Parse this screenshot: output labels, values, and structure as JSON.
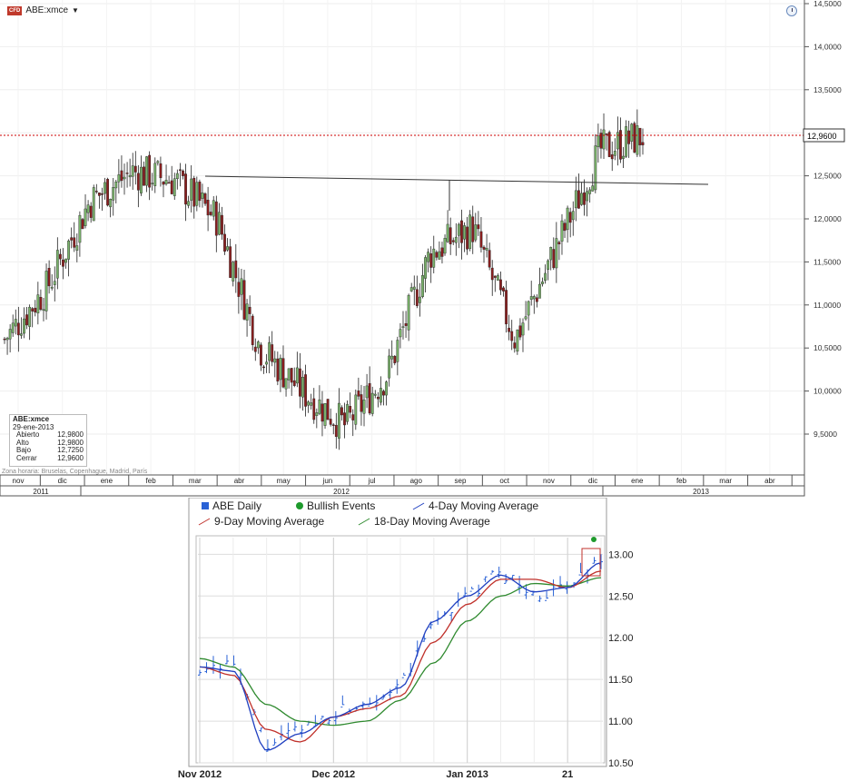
{
  "top": {
    "symbol": "ABE:xmce",
    "badge": "CFD",
    "price_tag": "12,9600",
    "y_ticks": [
      "14,5000",
      "14,0000",
      "13,5000",
      "13,0000",
      "12,5000",
      "12,0000",
      "11,5000",
      "11,0000",
      "10,5000",
      "10,0000",
      "9,5000"
    ],
    "months": [
      "nov",
      "dic",
      "ene",
      "feb",
      "mar",
      "abr",
      "may",
      "jun",
      "jul",
      "ago",
      "sep",
      "oct",
      "nov",
      "dic",
      "ene",
      "feb",
      "mar",
      "abr"
    ],
    "years": [
      "2011",
      "2012",
      "2013"
    ],
    "timezone": "Zona horaria: Bruselas, Copenhague, Madrid, París",
    "info": {
      "name": "ABE:xmce",
      "date": "29-ene-2013",
      "rows": [
        {
          "label": "Abierto",
          "value": "12,9800"
        },
        {
          "label": "Alto",
          "value": "12,9800"
        },
        {
          "label": "Bajo",
          "value": "12,7250"
        },
        {
          "label": "Cerrar",
          "value": "12,9600"
        }
      ]
    }
  },
  "chart_data": [
    {
      "type": "line",
      "title": "ABE:xmce",
      "x": [
        "2011-11-01",
        "2011-12-01",
        "2012-01-01",
        "2012-02-01",
        "2012-03-01",
        "2012-04-01",
        "2012-05-01",
        "2012-06-01",
        "2012-07-01",
        "2012-08-01",
        "2012-09-01",
        "2012-10-01",
        "2012-11-01",
        "2012-12-01",
        "2013-01-01",
        "2013-01-29"
      ],
      "series": [
        {
          "name": "",
          "values": [
            10.6,
            11.2,
            12.2,
            12.55,
            12.45,
            12.0,
            10.5,
            10.0,
            9.6,
            10.2,
            11.6,
            11.9,
            10.6,
            11.7,
            12.8,
            12.96
          ]
        }
      ],
      "ylim": [
        9.0,
        14.5
      ],
      "reference_lines": [
        {
          "kind": "horizontal-dotted",
          "value": 12.96,
          "color": "#cc0000"
        },
        {
          "kind": "trendline",
          "from": {
            "x": "2012-03-15",
            "y": 12.47
          },
          "to": {
            "x": "2013-03-01",
            "y": 12.38
          }
        }
      ],
      "grid": true
    },
    {
      "type": "line",
      "x": [
        "2012-11-01",
        "2012-11-08",
        "2012-11-15",
        "2012-11-22",
        "2012-12-01",
        "2012-12-08",
        "2012-12-15",
        "2012-12-22",
        "2013-01-01",
        "2013-01-08",
        "2013-01-15",
        "2013-01-21",
        "2013-01-29"
      ],
      "series": [
        {
          "name": "ABE Daily",
          "values": [
            11.65,
            11.7,
            10.7,
            10.9,
            11.1,
            11.25,
            11.4,
            12.2,
            12.5,
            12.8,
            12.5,
            12.6,
            12.96
          ]
        },
        {
          "name": "4-Day Moving Average",
          "values": [
            11.65,
            11.6,
            10.65,
            10.85,
            11.05,
            11.2,
            11.4,
            12.2,
            12.5,
            12.75,
            12.55,
            12.6,
            12.9
          ]
        },
        {
          "name": "9-Day Moving Average",
          "values": [
            11.65,
            11.55,
            10.9,
            10.75,
            11.05,
            11.15,
            11.3,
            11.95,
            12.4,
            12.7,
            12.7,
            12.6,
            12.8
          ]
        },
        {
          "name": "18-Day Moving Average",
          "values": [
            11.75,
            11.65,
            11.2,
            11.0,
            10.95,
            11.0,
            11.25,
            11.7,
            12.2,
            12.5,
            12.65,
            12.62,
            12.72
          ]
        }
      ],
      "legend": [
        "ABE Daily",
        "Bullish Events",
        "4-Day Moving Average",
        "9-Day Moving Average",
        "18-Day Moving Average"
      ],
      "y_ticks": [
        "13.00",
        "12.50",
        "12.00",
        "11.50",
        "11.00",
        "10.50"
      ],
      "x_ticks": [
        "Nov 2012",
        "Dec 2012",
        "Jan 2013",
        "21"
      ],
      "ylim": [
        10.5,
        13.2
      ],
      "grid": true,
      "colors": {
        "daily": "#2a62d6",
        "ma4": "#1f3fc0",
        "ma9": "#c0312b",
        "ma18": "#2f8a2f",
        "bullish": "#1e9a2c"
      }
    }
  ]
}
